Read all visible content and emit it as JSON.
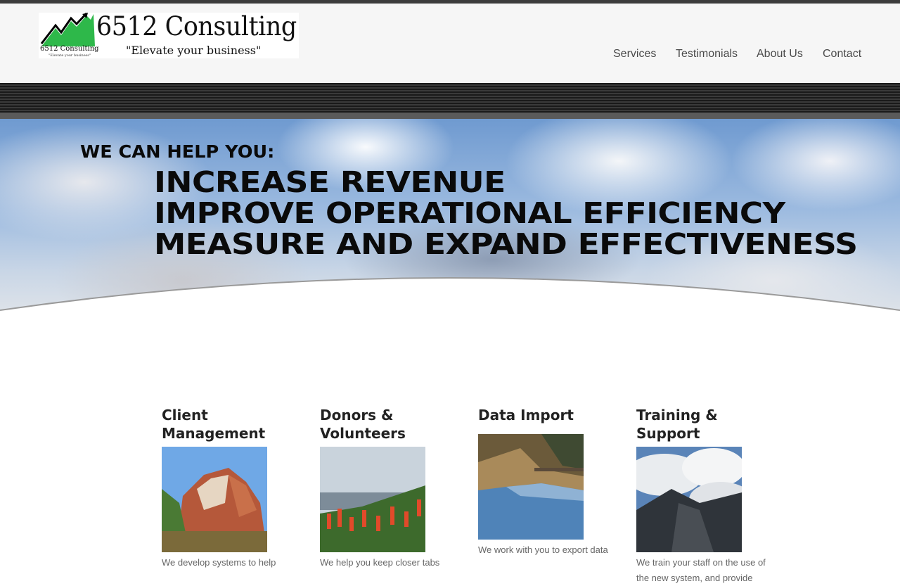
{
  "brand": {
    "name": "6512 Consulting",
    "tagline": "\"Elevate your business\"",
    "small_name": "6512 Consulting",
    "small_tagline": "\"Elevate your business\""
  },
  "nav": {
    "items": [
      {
        "label": "Services"
      },
      {
        "label": "Testimonials"
      },
      {
        "label": "About Us"
      },
      {
        "label": "Contact"
      }
    ]
  },
  "hero": {
    "lead": "WE CAN HELP YOU:",
    "lines": [
      "INCREASE REVENUE",
      "IMPROVE OPERATIONAL EFFICIENCY",
      "MEASURE AND EXPAND EFFECTIVENESS"
    ]
  },
  "services": [
    {
      "title": "Client\nManagement",
      "desc": "We develop systems to help"
    },
    {
      "title": "Donors &\nVolunteers",
      "desc": "We help you keep closer tabs"
    },
    {
      "title": "Data Import",
      "desc": "We work with you to export data"
    },
    {
      "title": "Training & Support",
      "desc": "We train your staff on the use of the new system, and provide"
    }
  ],
  "colors": {
    "top_bar": "#3c3c3c",
    "header_bg": "#f6f6f6",
    "nav_text": "#4a4a4a",
    "logo_green": "#2eb84a"
  }
}
